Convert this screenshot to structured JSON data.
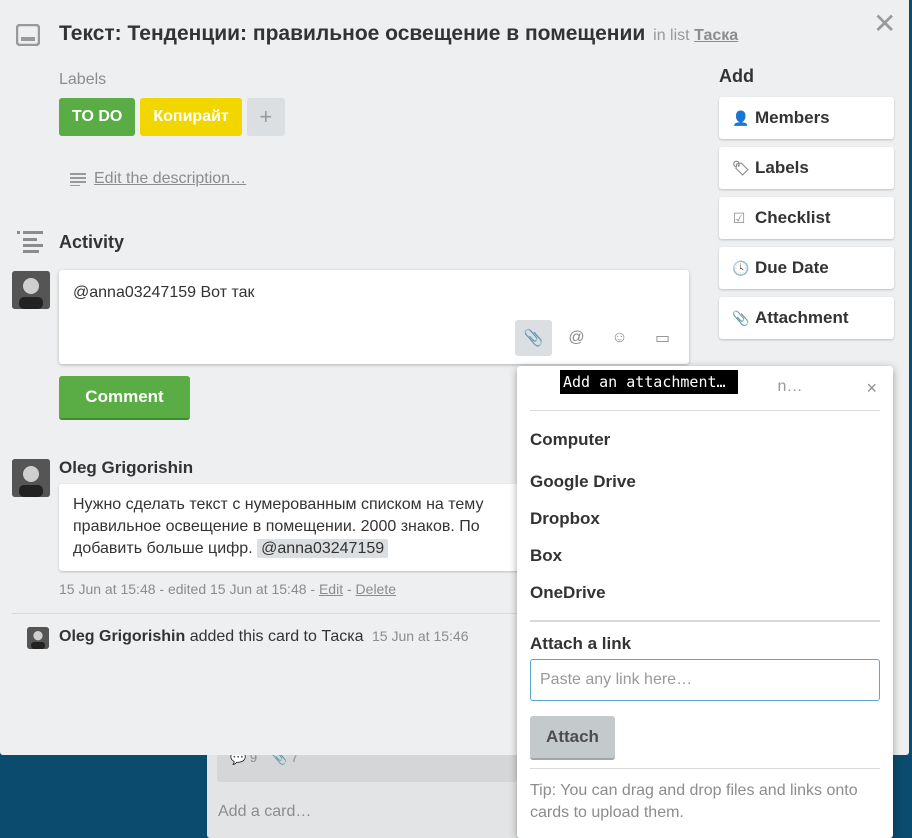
{
  "board": {
    "badges": {
      "comments": "9",
      "attachments": "7"
    },
    "add_card": "Add a card…"
  },
  "card": {
    "title": "Текст: Тенденции: правильное освещение в помещении",
    "in_list_prefix": "in list",
    "list_name": "Таска",
    "labels_heading": "Labels",
    "labels": [
      {
        "text": "TO DO",
        "color": "#5aac44"
      },
      {
        "text": "Копирайт",
        "color": "#f2d600"
      }
    ],
    "label_add": "+",
    "edit_description": "Edit the description…"
  },
  "activity": {
    "title": "Activity",
    "draft_comment": "@anna03247159 Вот так",
    "comment_button": "Comment",
    "entries": [
      {
        "author": "Oleg Grigorishin",
        "text": "Нужно сделать текст с нумерованным списком на тему правильное освещение в помещении. 2000 знаков. По добавить больше цифр.",
        "mention": "@anna03247159",
        "meta_time": "15 Jun at 15:48 - edited 15 Jun at 15:48 -",
        "edit": "Edit",
        "sep": "-",
        "delete": "Delete"
      }
    ],
    "added": {
      "author": "Oleg Grigorishin",
      "action": "added this card to Таска",
      "time": "15 Jun at 15:46"
    }
  },
  "sidebar": {
    "heading": "Add",
    "buttons": [
      "Members",
      "Labels",
      "Checklist",
      "Due Date",
      "Attachment"
    ]
  },
  "popover": {
    "title_partial": "n…",
    "close": "×",
    "sources": [
      "Computer",
      "Google Drive",
      "Dropbox",
      "Box",
      "OneDrive"
    ],
    "link_heading": "Attach a link",
    "link_placeholder": "Paste any link here…",
    "attach_button": "Attach",
    "tip": "Tip: You can drag and drop files and links onto cards to upload them."
  },
  "tooltip": "Add an attachment…"
}
